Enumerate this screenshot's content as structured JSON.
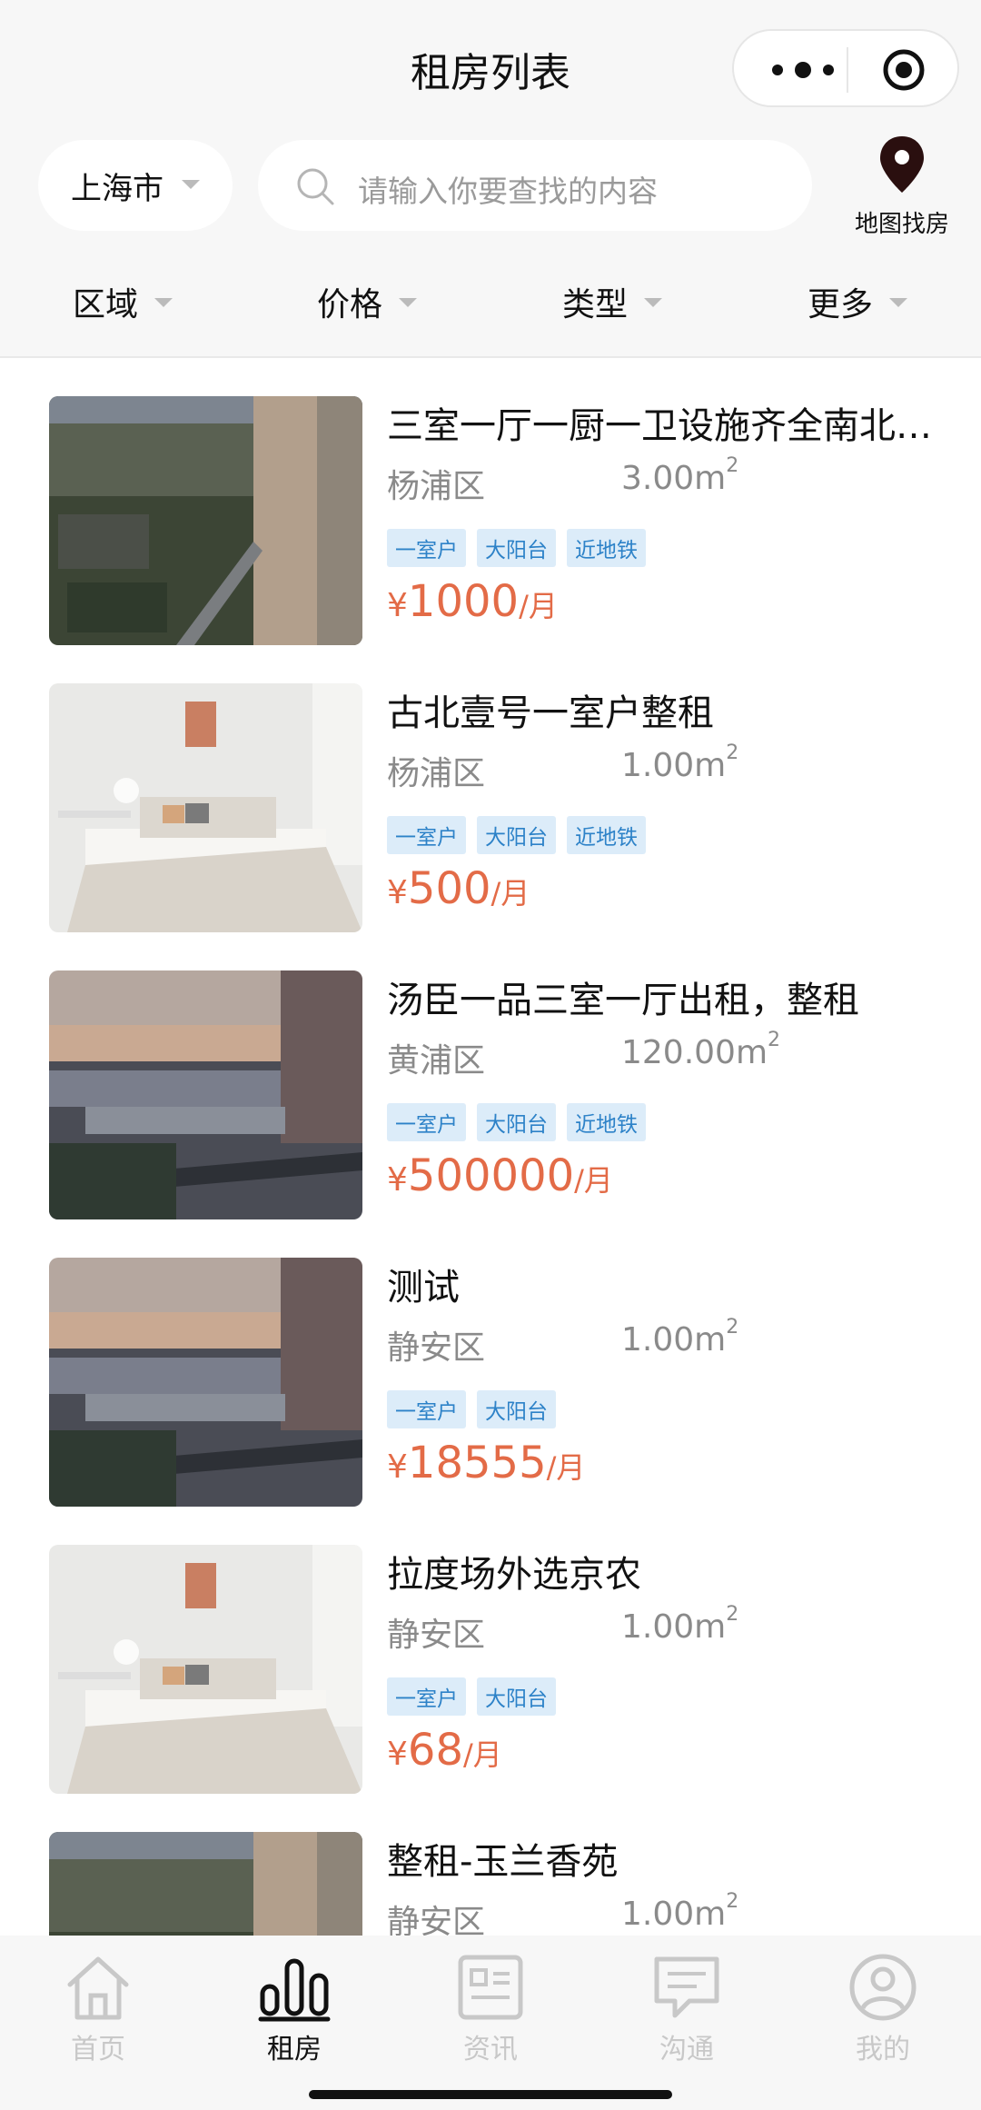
{
  "header": {
    "title": "租房列表"
  },
  "search": {
    "city": "上海市",
    "placeholder": "请输入你要查找的内容",
    "map_label": "地图找房"
  },
  "filters": [
    "区域",
    "价格",
    "类型",
    "更多"
  ],
  "listings": [
    {
      "title": "三室一厅一厨一卫设施齐全南北通透",
      "district": "杨浦区",
      "area": "3.00m",
      "area_unit_sup": "2",
      "tags": [
        "一室户",
        "大阳台",
        "近地铁"
      ],
      "currency": "¥",
      "price": "1000",
      "unit": "/月",
      "photo": "aerial-city"
    },
    {
      "title": "古北壹号一室户整租",
      "district": "杨浦区",
      "area": "1.00m",
      "area_unit_sup": "2",
      "tags": [
        "一室户",
        "大阳台",
        "近地铁"
      ],
      "currency": "¥",
      "price": "500",
      "unit": "/月",
      "photo": "bedroom"
    },
    {
      "title": "汤臣一品三室一厅出租，整租",
      "district": "黄浦区",
      "area": "120.00m",
      "area_unit_sup": "2",
      "tags": [
        "一室户",
        "大阳台",
        "近地铁"
      ],
      "currency": "¥",
      "price": "500000",
      "unit": "/月",
      "photo": "city-dusk"
    },
    {
      "title": "测试",
      "district": "静安区",
      "area": "1.00m",
      "area_unit_sup": "2",
      "tags": [
        "一室户",
        "大阳台"
      ],
      "currency": "¥",
      "price": "18555",
      "unit": "/月",
      "photo": "city-dusk"
    },
    {
      "title": "拉度场外选京农",
      "district": "静安区",
      "area": "1.00m",
      "area_unit_sup": "2",
      "tags": [
        "一室户",
        "大阳台"
      ],
      "currency": "¥",
      "price": "68",
      "unit": "/月",
      "photo": "bedroom"
    },
    {
      "title": "整租-玉兰香苑",
      "district": "静安区",
      "area": "1.00m",
      "area_unit_sup": "2",
      "tags": [],
      "currency": "",
      "price": "",
      "unit": "",
      "photo": "aerial-city"
    }
  ],
  "tabbar": [
    {
      "label": "首页",
      "icon": "home-icon",
      "active": false
    },
    {
      "label": "租房",
      "icon": "rent-chart-icon",
      "active": true
    },
    {
      "label": "资讯",
      "icon": "news-icon",
      "active": false
    },
    {
      "label": "沟通",
      "icon": "chat-icon",
      "active": false
    },
    {
      "label": "我的",
      "icon": "profile-icon",
      "active": false
    }
  ],
  "colors": {
    "price": "#e36b47",
    "tag_bg": "#dcecf9",
    "tag_text": "#2d82c8",
    "inactive_tab": "#c8c8c8"
  }
}
